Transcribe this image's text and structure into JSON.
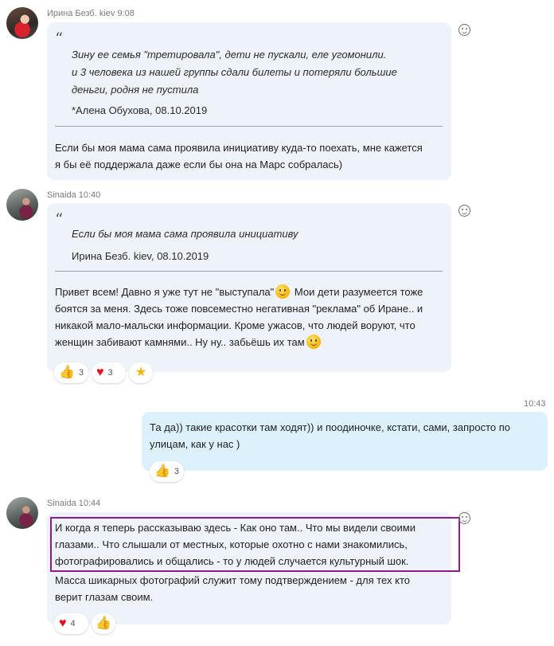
{
  "messages": {
    "m1": {
      "sender": "Ирина Безб. kiev",
      "time": "9:08",
      "quote_lines": [
        "Зину ее семья \"третировала\", дети не пускали, еле угомонили.",
        "и 3 человека из нашей группы сдали билеты и потеряли большие",
        "деньги, родня не пустила"
      ],
      "quote_author": "*Алена Обухова, 08.10.2019",
      "text_lines": [
        "Если бы моя мама сама проявила инициативу куда-то поехать, мне кажется",
        "я бы её поддержала  даже если бы она на Марс собралась)"
      ]
    },
    "m2": {
      "sender": "Sinaida",
      "time": "10:40",
      "quote_lines": [
        "Если бы моя мама сама проявила инициативу"
      ],
      "quote_author": "Ирина Безб. kiev, 08.10.2019",
      "line1_a": "Привет всем! Давно я уже тут не \"выступала\"",
      "line1_b": " Мои дети разумеется тоже",
      "text_lines": [
        "боятся за меня. Здесь тоже повсеместно негативная \"реклама\" об Иране.. и",
        "никакой мало-мальски информации. Кроме ужасов, что людей воруют, что"
      ],
      "line4": "женщин забивают камнями.. Ну ну.. забьёшь их там",
      "reactions": [
        {
          "icon": "thumbs-up-icon",
          "glyph": "👍",
          "count": "3"
        },
        {
          "icon": "heart-icon",
          "glyph": "♥",
          "count": "3"
        },
        {
          "icon": "star-icon",
          "glyph": "★",
          "count": ""
        }
      ]
    },
    "m3": {
      "time": "10:43",
      "text_lines": [
        "Та да)) такие красотки там ходят)) и поодиночке, кстати, сами, запросто по",
        "улицам, как у нас )"
      ],
      "reactions": [
        {
          "icon": "thumbs-up-icon",
          "glyph": "👍",
          "count": "3"
        }
      ]
    },
    "m4": {
      "sender": "Sinaida",
      "time": "10:44",
      "text_lines": [
        "И когда я теперь рассказываю здесь - Как оно там.. Что мы видели своими",
        "глазами.. Что слышали от местных, которые охотно с нами знакомились,",
        "фотографировались и общались - то у людей случается культурный шок.",
        "Масса шикарных фотографий служит тому подтверждением - для тех кто",
        "верит глазам своим."
      ],
      "reactions": [
        {
          "icon": "heart-icon",
          "glyph": "♥",
          "count": "4"
        },
        {
          "icon": "thumbs-up-icon",
          "glyph": "👍",
          "count": ""
        }
      ]
    }
  },
  "colors": {
    "bubble_other": "#eef3fa",
    "bubble_mine": "#dcf1fc",
    "highlight": "#8e1a8f"
  }
}
